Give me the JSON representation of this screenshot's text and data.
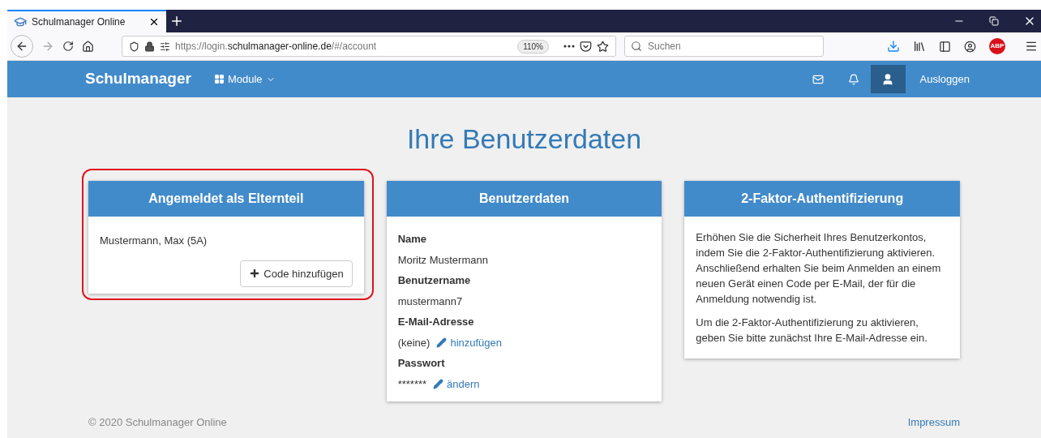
{
  "browser": {
    "tab_title": "Schulmanager Online",
    "url_prefix": "https://login.",
    "url_domain": "schulmanager-online.de",
    "url_path": "/#/account",
    "zoom": "110%",
    "search_placeholder": "Suchen",
    "abp_label": "ABP"
  },
  "navbar": {
    "brand": "Schulmanager",
    "menu": "Module",
    "logout": "Ausloggen"
  },
  "page_title": "Ihre Benutzerdaten",
  "cards": [
    {
      "kind": "children",
      "title": "Angemeldet als Elternteil",
      "highlighted": true,
      "child": "Mustermann, Max (5A)",
      "button": "Code hinzufügen"
    },
    {
      "kind": "fields",
      "title": "Benutzerdaten",
      "highlighted": false,
      "fields": [
        {
          "label": "Name",
          "value": "Moritz Mustermann"
        },
        {
          "label": "Benutzername",
          "value": "mustermann7"
        },
        {
          "label": "E-Mail-Adresse",
          "value": "(keine)",
          "link": "hinzufügen"
        },
        {
          "label": "Passwort",
          "value": "*******",
          "link": "ändern"
        }
      ]
    },
    {
      "kind": "text",
      "title": "2-Faktor-Authentifizierung",
      "highlighted": false,
      "paragraphs": [
        "Erhöhen Sie die Sicherheit Ihres Benutzerkontos, indem Sie die 2-Faktor-Authentifizierung aktivieren. Anschließend erhalten Sie beim Anmelden an einem neuen Gerät einen Code per E-Mail, der für die Anmeldung notwendig ist.",
        "Um die 2-Faktor-Authentifizierung zu aktivieren, geben Sie bitte zunächst Ihre E-Mail-Adresse ein."
      ]
    }
  ],
  "footer": {
    "copyright": "© 2020 Schulmanager Online",
    "link": "Impressum"
  }
}
